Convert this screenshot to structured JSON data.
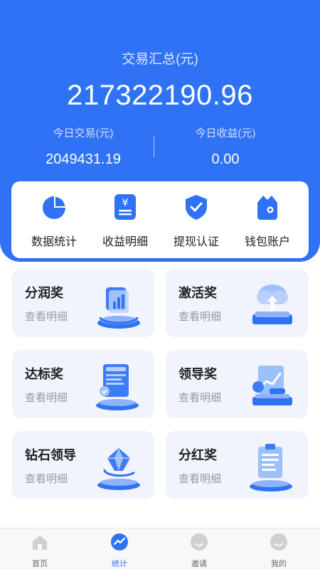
{
  "summary": {
    "title": "交易汇总(元)",
    "total": "217322190.96",
    "today_trade_label": "今日交易(元)",
    "today_trade_value": "2049431.19",
    "today_income_label": "今日收益(元)",
    "today_income_value": "0.00"
  },
  "quick_actions": [
    {
      "label": "数据统计",
      "icon": "pie-chart-icon"
    },
    {
      "label": "收益明细",
      "icon": "yuan-bill-icon"
    },
    {
      "label": "提现认证",
      "icon": "check-shield-icon"
    },
    {
      "label": "钱包账户",
      "icon": "wallet-icon"
    }
  ],
  "rewards": [
    {
      "title": "分润奖",
      "sub": "查看明细",
      "icon": "bar-chart-podium-icon"
    },
    {
      "title": "激活奖",
      "sub": "查看明细",
      "icon": "cloud-podium-icon"
    },
    {
      "title": "达标奖",
      "sub": "查看明细",
      "icon": "document-podium-icon"
    },
    {
      "title": "领导奖",
      "sub": "查看明细",
      "icon": "line-chart-podium-icon"
    },
    {
      "title": "钻石领导",
      "sub": "查看明细",
      "icon": "diamond-podium-icon"
    },
    {
      "title": "分红奖",
      "sub": "查看明细",
      "icon": "clipboard-podium-icon"
    }
  ],
  "tabs": [
    {
      "label": "首页",
      "icon": "home-icon",
      "active": false
    },
    {
      "label": "统计",
      "icon": "stats-icon",
      "active": true
    },
    {
      "label": "邀请",
      "icon": "invite-icon",
      "active": false
    },
    {
      "label": "我的",
      "icon": "profile-icon",
      "active": false
    }
  ],
  "colors": {
    "primary": "#2f72f5",
    "card_bg": "#f1f4fc",
    "inactive_icon": "#d0d0d0"
  }
}
